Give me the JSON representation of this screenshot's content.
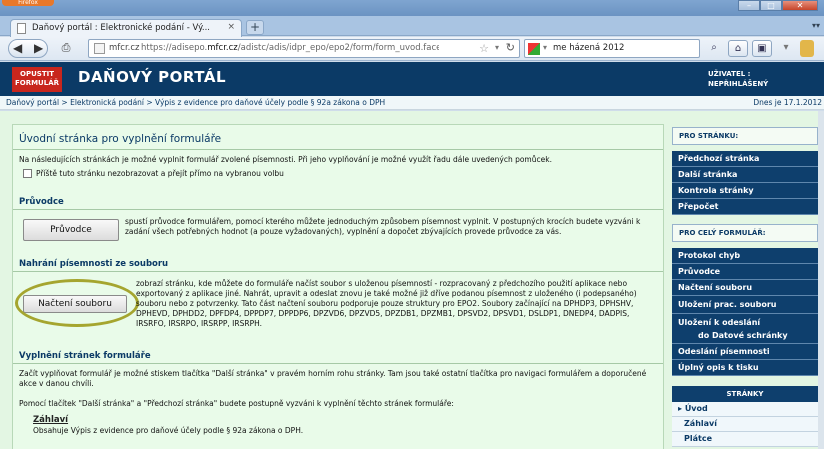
{
  "browser": {
    "app_button": "Firefox",
    "tab_title": "Daňový portál : Elektronické podání - Vý...",
    "tab_close": "×",
    "new_tab": "+",
    "url_site": "mfcr.cz",
    "url_prefix": "https://adisepo.",
    "url_domain": "mfcr.cz",
    "url_path": "/adistc/adis/idpr_epo/epo2/form/form_uvod.faces?CPodan",
    "search_query": "me házená 2012"
  },
  "header": {
    "close_form_label": "OPUSTIT FORMULÁŘ",
    "title": "DAŇOVÝ PORTÁL",
    "user_label": "UŽIVATEL :",
    "user_value": "NEPŘIHLÁŠENÝ"
  },
  "breadcrumb": "Daňový portál > Elektronická podání > Výpis z evidence pro daňové účely podle § 92a zákona o DPH",
  "today": "Dnes je 17.1.2012",
  "main": {
    "title": "Úvodní stránka pro vyplnění formuláře",
    "intro": "Na následujících stránkách je možné vyplnit formulář zvolené písemnosti. Při jeho vyplňování je možné využít řadu dále uvedených pomůcek.",
    "checkbox_label": "Příště tuto stránku nezobrazovat a přejít přímo na vybranou volbu",
    "pruvodce_title": "Průvodce",
    "pruvodce_button": "Průvodce",
    "pruvodce_text": "spustí průvodce formulářem, pomocí kterého můžete jednoduchým způsobem písemnost vyplnit. V postupných krocích budete vyzváni k zadání všech potřebných hodnot (a pouze vyžadovaných), vyplnění a dopočet zbývajících provede průvodce za vás.",
    "upload_title": "Nahrání písemnosti ze souboru",
    "upload_button": "Načtení souboru",
    "upload_text": "zobrazí stránku, kde můžete do formuláře načíst soubor s uloženou písemností - rozpracovaný z předchozího použití aplikace nebo exportovaný z aplikace jiné. Nahrát, upravit a odeslat znovu je také možné již dříve podanou písemnost z uloženého (i podepsaného) souboru nebo z potvrzenky. Tato část načtení souboru podporuje pouze struktury pro EPO2. Soubory začínající na DPHDP3, DPHSHV, DPHEVD, DPHDD2, DPFDP4, DPPDP7, DPPDP6, DPZVD6, DPZVD5, DPZDB1, DPZMB1, DPSVD2, DPSVD1, DSLDP1, DNEDP4, DADPIS, IRSRFO, IRSRPO, IRSRPP, IRSRPH.",
    "fill_title": "Vyplnění stránek formuláře",
    "fill_text1": "Začít vyplňovat formulář je možné stiskem tlačítka \"Další stránka\" v pravém horním rohu stránky. Tam jsou také ostatní tlačítka pro navigaci formulářem a doporučené akce v danou chvíli.",
    "fill_text2": "Pomocí tlačítek \"Další stránka\" a \"Předchozí stránka\" budete postupně vyzváni k vyplnění těchto stránek formuláře:",
    "zahlavi_link": "Záhlaví",
    "zahlavi_text": "Obsahuje Výpis z evidence pro daňové účely podle § 92a zákona o DPH."
  },
  "sidebar": {
    "page_head": "PRO STRÁNKU:",
    "page_items": [
      "Předchozí stránka",
      "Další stránka",
      "Kontrola stránky",
      "Přepočet"
    ],
    "form_head": "PRO CELÝ FORMULÁŘ:",
    "form_items": [
      "Protokol chyb",
      "Průvodce",
      "Načtení souboru",
      "Uložení prac. souboru",
      "Uložení k odeslání",
      "do Datové schránky",
      "Odeslání písemnosti",
      "Úplný opis k tisku"
    ],
    "pages_head": "STRÁNKY",
    "pages_items": [
      "Úvod",
      "Záhlaví",
      "Plátce"
    ],
    "active_marker": "▸"
  }
}
